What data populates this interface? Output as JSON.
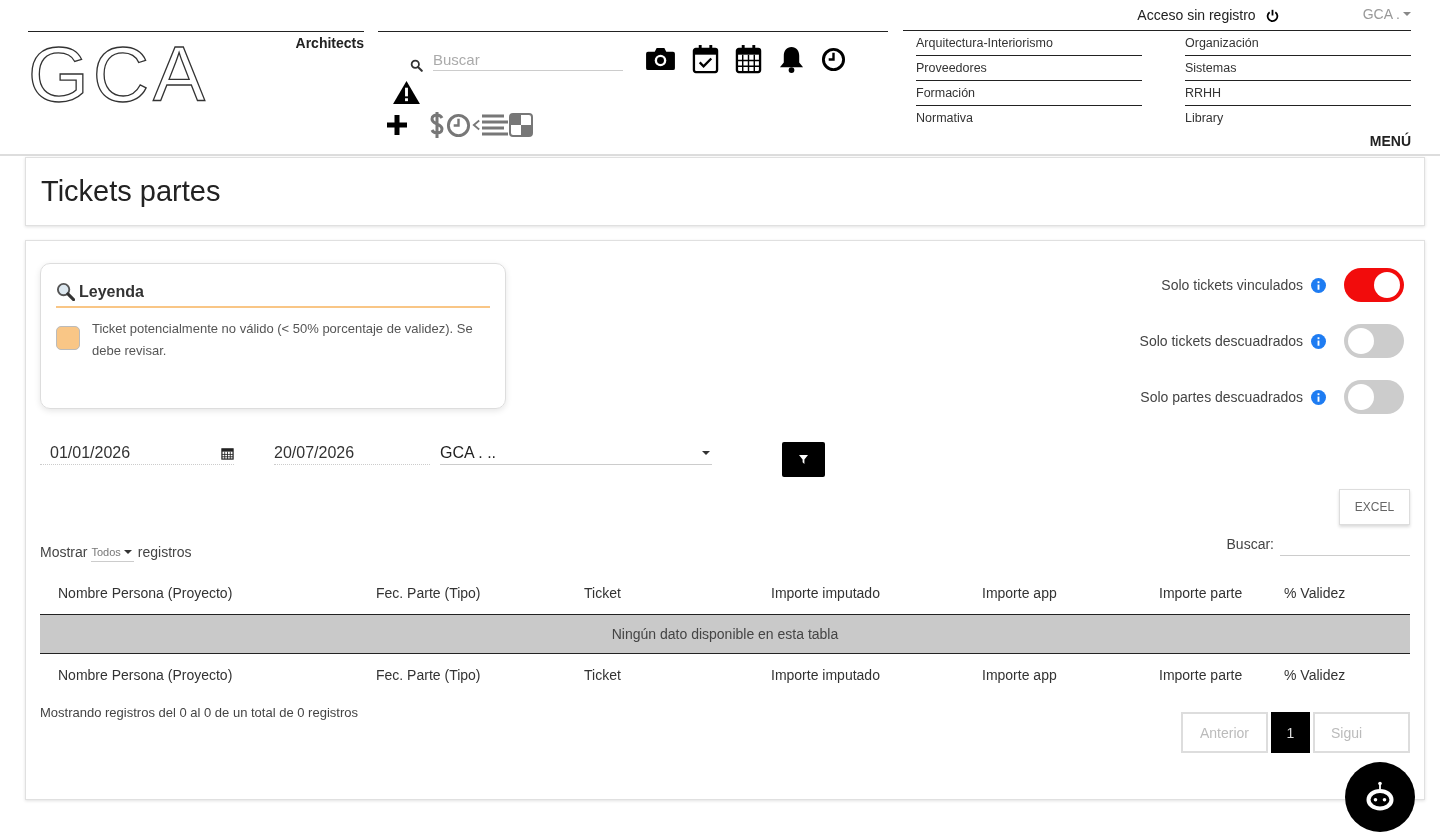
{
  "header": {
    "logo": "GCA",
    "tagline": "Architects",
    "search": {
      "placeholder": "Buscar"
    },
    "access_link": "Acceso sin registro",
    "company_dropdown": "GCA .",
    "menu_columns": [
      {
        "items": [
          "Arquitectura-Interiorismo",
          "Proveedores",
          "Formación",
          "Normativa"
        ]
      },
      {
        "items": [
          "Organización",
          "Sistemas",
          "RRHH",
          "Library"
        ]
      }
    ],
    "menu_label": "MENÚ"
  },
  "page_title": "Tickets partes",
  "legend": {
    "title": "Leyenda",
    "items": [
      {
        "color": "#f9c686",
        "text": "Ticket potencialmente no válido (< 50% porcentaje de validez). Se debe revisar."
      }
    ]
  },
  "toggles": [
    {
      "label": "Solo tickets vinculados",
      "on": true
    },
    {
      "label": "Solo tickets descuadrados",
      "on": false
    },
    {
      "label": "Solo partes descuadrados",
      "on": false
    }
  ],
  "filters": {
    "date_from": "01/01/2026",
    "date_to": "20/07/2026",
    "company": "GCA . .."
  },
  "excel_button": "EXCEL",
  "table_controls": {
    "show_prefix": "Mostrar",
    "page_size": "Todos",
    "show_suffix": "registros",
    "search_label": "Buscar:"
  },
  "table": {
    "columns": [
      "Nombre Persona (Proyecto)",
      "Fec. Parte (Tipo)",
      "Ticket",
      "Importe imputado",
      "Importe app",
      "Importe parte",
      "% Validez"
    ],
    "empty_message": "Ningún dato disponible en esta tabla",
    "footer_columns": [
      "Nombre Persona (Proyecto)",
      "Fec. Parte (Tipo)",
      "Ticket",
      "Importe imputado",
      "Importe app",
      "Importe parte",
      "% Validez"
    ]
  },
  "info": "Mostrando registros del 0 al 0 de un total de 0 registros",
  "pagination": [
    {
      "label": "Anterior",
      "selected": false
    },
    {
      "label": "1",
      "selected": true
    },
    {
      "label": "Sigui",
      "selected": false
    }
  ]
}
